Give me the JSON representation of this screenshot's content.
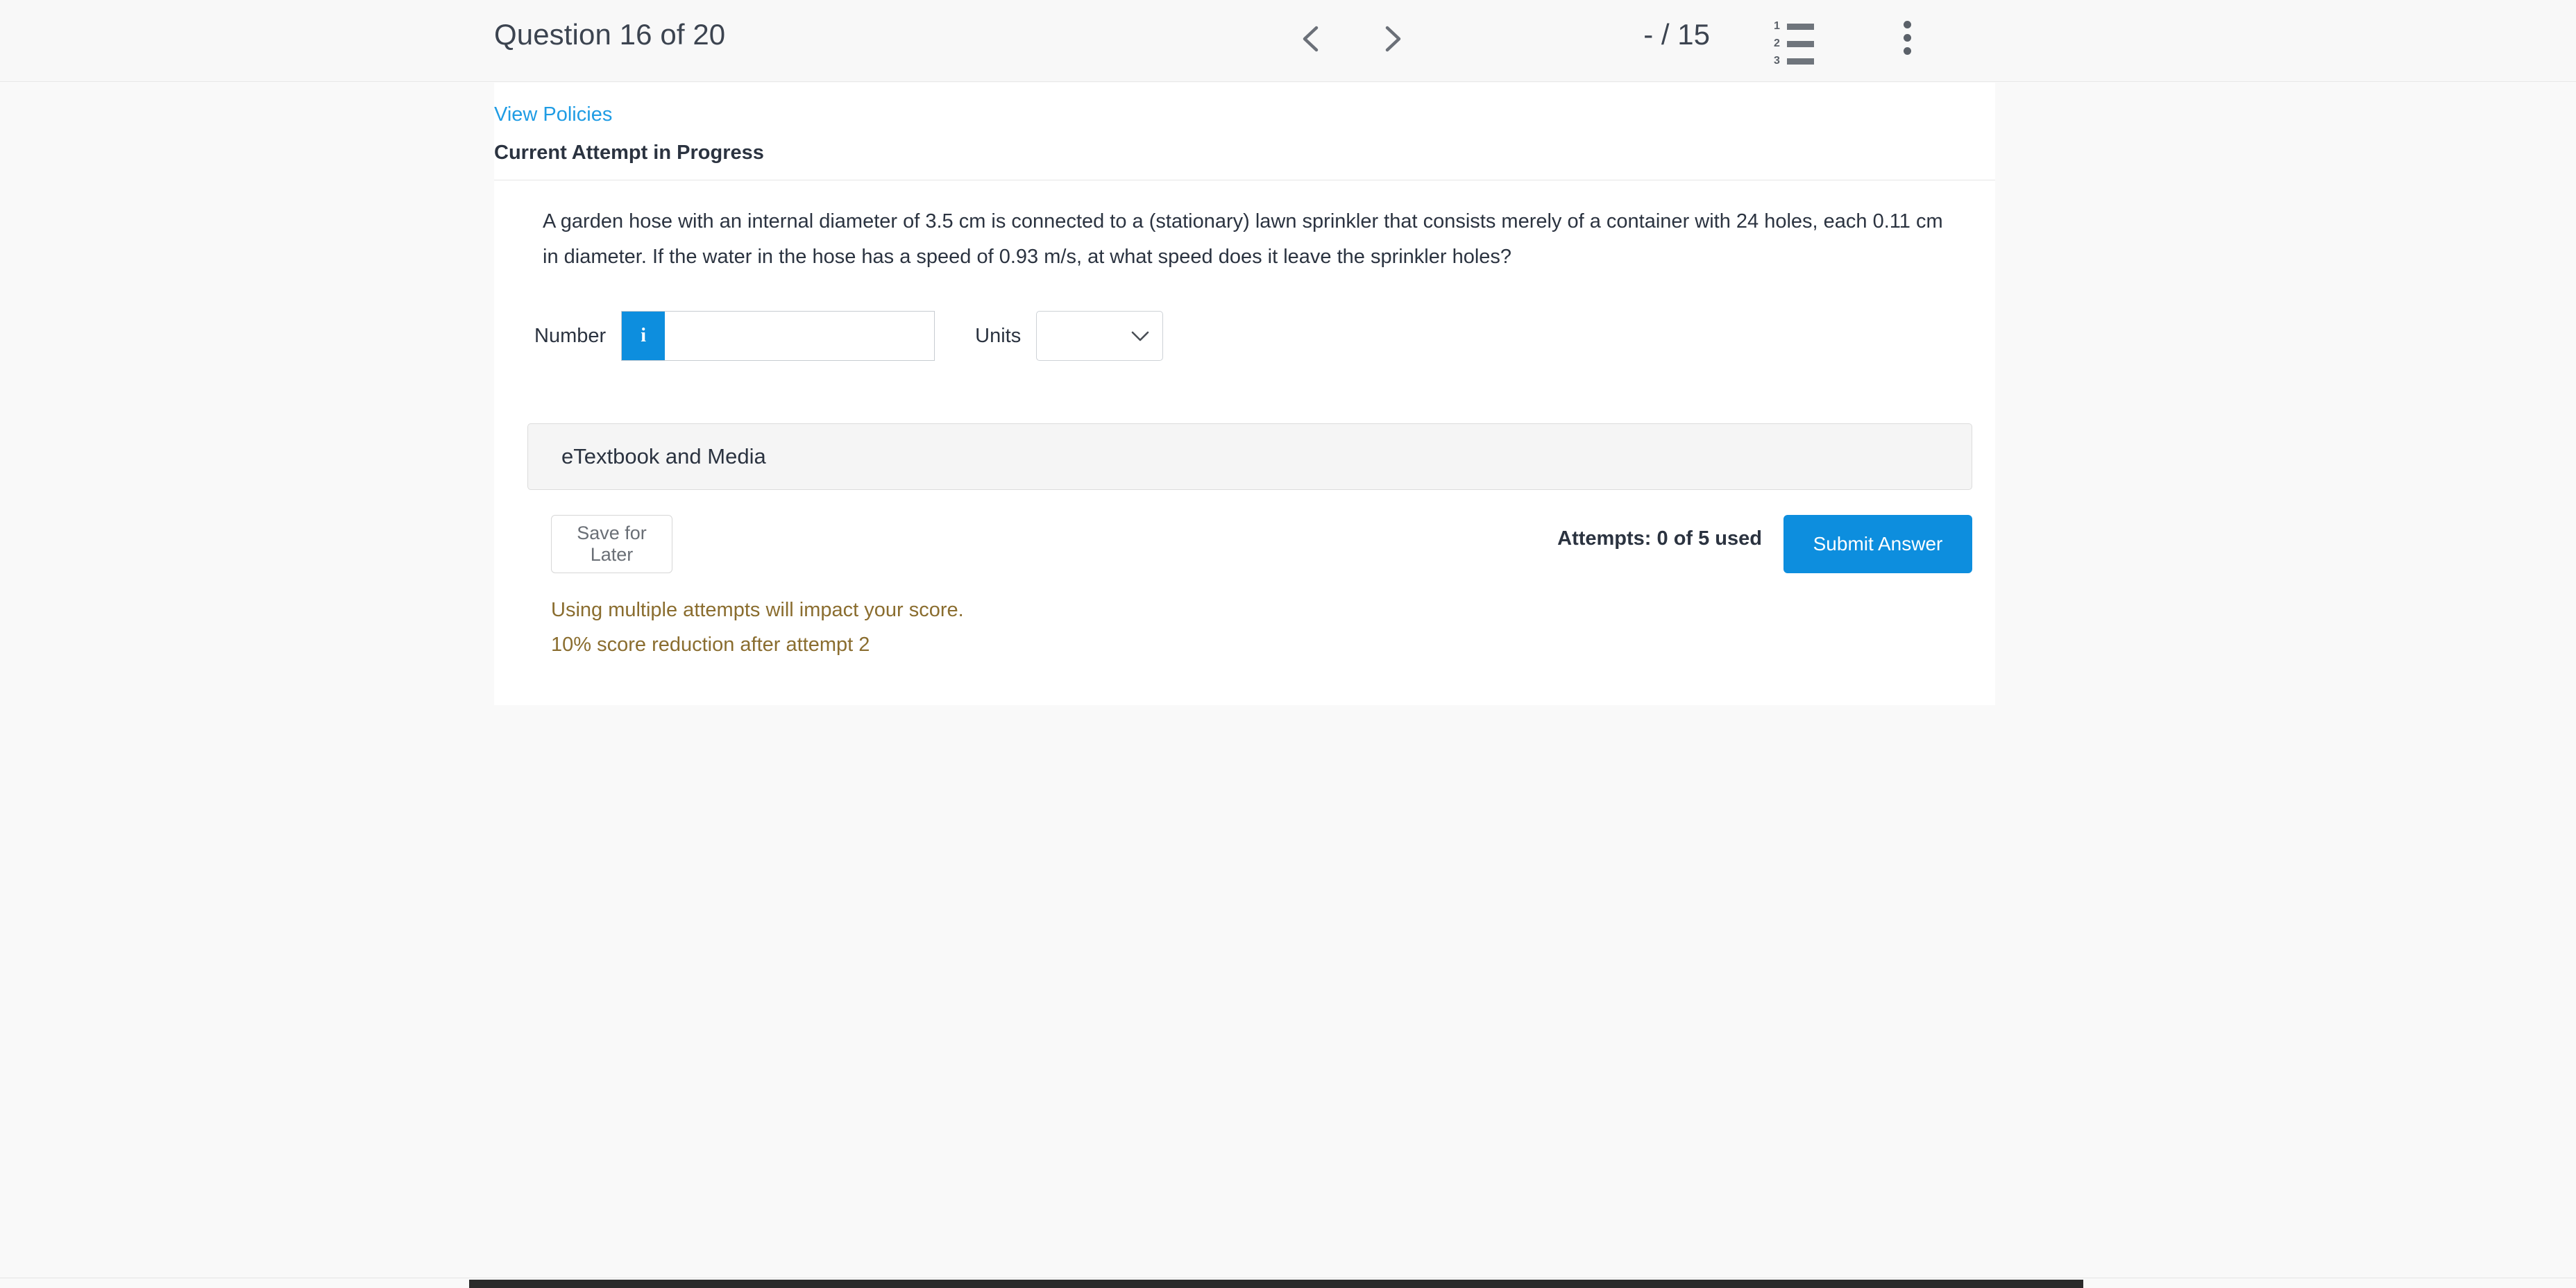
{
  "header": {
    "question_title": "Question 16 of 20",
    "prev_label": "Previous question",
    "next_label": "Next question",
    "score": "- / 15",
    "list_icon": "numbered-list-icon",
    "menu_icon": "kebab-menu-icon",
    "list_numbers": [
      "1",
      "2",
      "3"
    ]
  },
  "card": {
    "view_policies": "View Policies",
    "attempt_heading": "Current Attempt in Progress",
    "question_text": "A garden hose with an internal diameter of 3.5 cm is connected to a (stationary) lawn sprinkler that consists merely of a container with 24 holes, each 0.11 cm in diameter. If the water in the hose has a speed of 0.93 m/s, at what speed does it leave the sprinkler holes?",
    "number_label": "Number",
    "number_value": "",
    "number_placeholder": "",
    "info_glyph": "i",
    "units_label": "Units",
    "units_value": "",
    "units_options": [
      ""
    ],
    "etextbook_label": "eTextbook and Media",
    "save_label": "Save for Later",
    "attempts_text": "Attempts: 0 of 5 used",
    "submit_label": "Submit Answer",
    "warning_line_1": "Using multiple attempts will impact your score.",
    "warning_line_2": "10% score reduction after attempt 2"
  },
  "colors": {
    "accent_blue": "#0d8ede",
    "link_blue": "#1f9ce4",
    "warning_brown": "#8a6d2f",
    "page_bg": "#f9f9f9",
    "card_bg": "#ffffff"
  }
}
